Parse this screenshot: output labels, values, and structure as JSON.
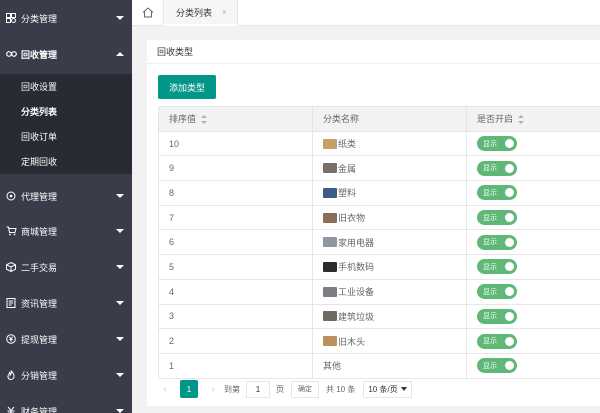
{
  "sidebar": {
    "items": [
      {
        "label": "分类管理",
        "icon": "category-icon"
      },
      {
        "label": "回收管理",
        "icon": "recycle-icon",
        "open": true,
        "children": [
          {
            "label": "回收设置"
          },
          {
            "label": "分类列表",
            "active": true
          },
          {
            "label": "回收订单"
          },
          {
            "label": "定期回收"
          }
        ]
      },
      {
        "label": "代理管理",
        "icon": "agent-icon"
      },
      {
        "label": "商城管理",
        "icon": "cart-icon"
      },
      {
        "label": "二手交易",
        "icon": "cube-icon"
      },
      {
        "label": "资讯管理",
        "icon": "news-icon"
      },
      {
        "label": "提现管理",
        "icon": "withdraw-icon"
      },
      {
        "label": "分销管理",
        "icon": "fire-icon"
      },
      {
        "label": "财务管理",
        "icon": "finance-icon"
      }
    ]
  },
  "tabs": [
    {
      "label": "分类列表",
      "close": "×"
    }
  ],
  "card": {
    "title": "回收类型",
    "add_button": "添加类型"
  },
  "table": {
    "columns": [
      "排序值",
      "分类名称",
      "是否开启"
    ],
    "rows": [
      {
        "sort": "10",
        "name": "纸类",
        "thumb": "#c9a063",
        "switch": "显示"
      },
      {
        "sort": "9",
        "name": "金属",
        "thumb": "#7a7068",
        "switch": "显示"
      },
      {
        "sort": "8",
        "name": "塑料",
        "thumb": "#3d5a8a",
        "switch": "显示"
      },
      {
        "sort": "7",
        "name": "旧衣物",
        "thumb": "#8a6e55",
        "switch": "显示"
      },
      {
        "sort": "6",
        "name": "家用电器",
        "thumb": "#8f96a3",
        "switch": "显示"
      },
      {
        "sort": "5",
        "name": "手机数码",
        "thumb": "#2d2d2d",
        "switch": "显示"
      },
      {
        "sort": "4",
        "name": "工业设备",
        "thumb": "#7b7f84",
        "switch": "显示"
      },
      {
        "sort": "3",
        "name": "建筑垃圾",
        "thumb": "#6e6a63",
        "switch": "显示"
      },
      {
        "sort": "2",
        "name": "旧木头",
        "thumb": "#b9925a",
        "switch": "显示"
      },
      {
        "sort": "1",
        "name": "其他",
        "thumb": "",
        "switch": "显示"
      }
    ]
  },
  "pager": {
    "current_page": "1",
    "goto_label": "到第",
    "goto_value": "1",
    "page_unit": "页",
    "confirm": "确定",
    "total": "共 10 条",
    "page_size": "10 条/页"
  },
  "colors": {
    "sidebar_bg": "#393d49",
    "subnav_bg": "#282b33",
    "accent": "#009688",
    "switch_on": "#5fb878"
  }
}
